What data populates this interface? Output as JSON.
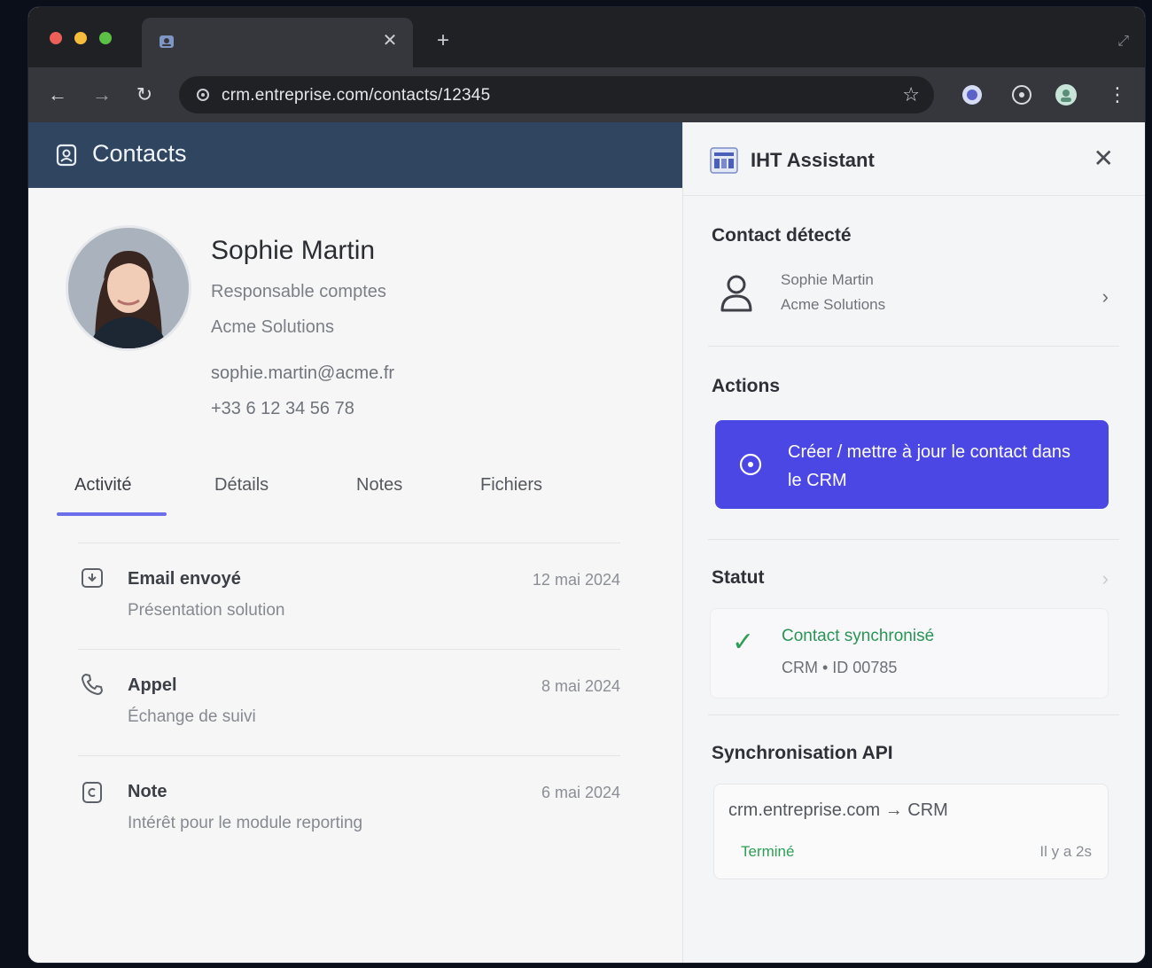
{
  "browser": {
    "url": "crm.entreprise.com/contacts/12345"
  },
  "crm": {
    "header_title": "Contacts",
    "contact": {
      "name": "Sophie Martin",
      "role": "Responsable comptes",
      "company": "Acme Solutions",
      "email": "sophie.martin@acme.fr",
      "phone": "+33 6 12 34 56 78"
    },
    "tabs": [
      "Activité",
      "Détails",
      "Notes",
      "Fichiers"
    ],
    "activities": [
      {
        "icon": "email-icon",
        "title": "Email envoyé",
        "subtitle": "Présentation solution",
        "date": "12 mai 2024"
      },
      {
        "icon": "phone-icon",
        "title": "Appel",
        "subtitle": "Échange de suivi",
        "date": "8 mai 2024"
      },
      {
        "icon": "note-icon",
        "title": "Note",
        "subtitle": "Intérêt pour le module reporting",
        "date": "6 mai 2024"
      }
    ]
  },
  "assistant": {
    "title": "IHT Assistant",
    "detected_title": "Contact détecté",
    "detected_name": "Sophie Martin",
    "detected_company": "Acme Solutions",
    "actions_title": "Actions",
    "action_label": "Créer / mettre à jour le contact dans le CRM",
    "status_title": "Statut",
    "status_text": "Contact synchronisé",
    "status_id": "CRM • ID 00785",
    "sync_title": "Synchronisation API",
    "sync_route": "crm.entreprise.com → CRM",
    "sync_state": "Terminé",
    "sync_time": "Il y a 2s"
  },
  "colors": {
    "header_bg": "#2f4560",
    "accent": "#4b47e4",
    "tab_underline": "#6c6fe9",
    "success": "#2d9f55"
  }
}
